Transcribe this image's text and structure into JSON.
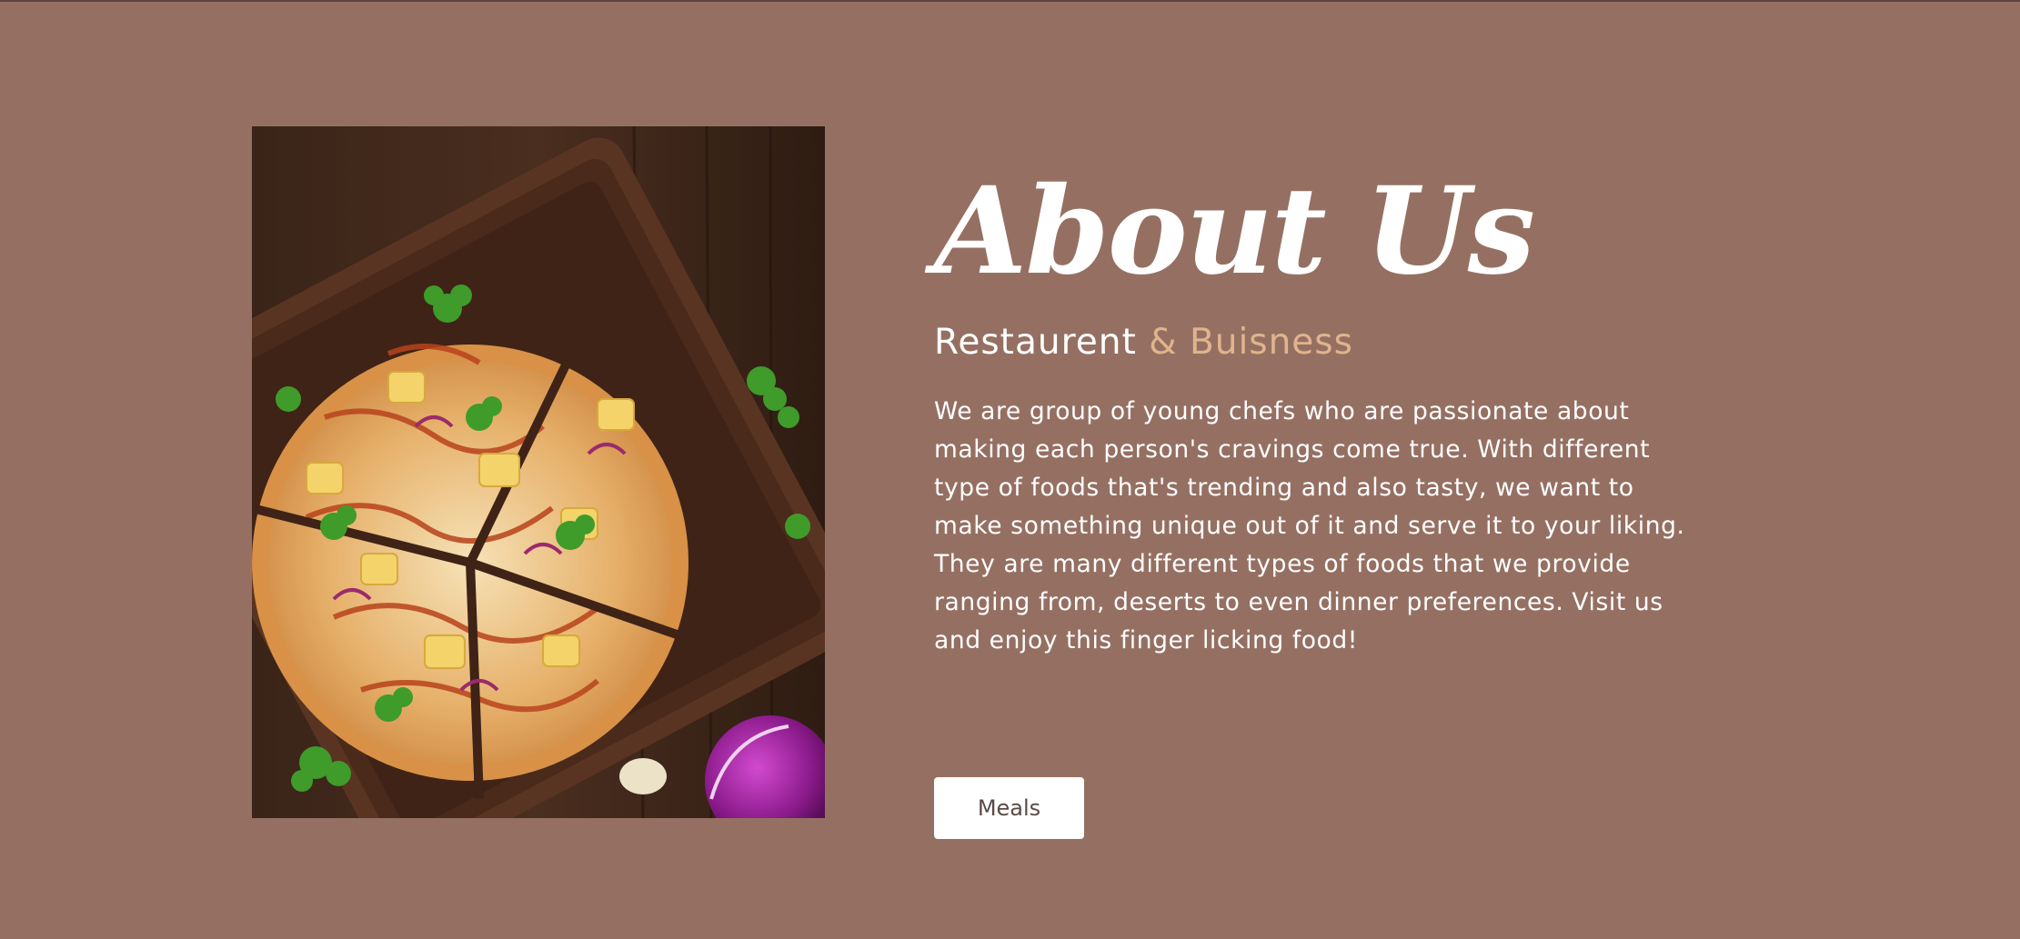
{
  "about": {
    "title": "About Us",
    "subtitle_main": "Restaurent",
    "subtitle_accent": "& Buisness",
    "description": "We are group of young chefs who are passionate about making each person's cravings come true. With different type of foods that's trending and also tasty, we want to make something unique out of it and serve it to your liking. They are many different types of foods that we provide ranging from, deserts to even dinner preferences. Visit us and enjoy this finger licking food!",
    "button_label": "Meals"
  },
  "image": {
    "subject": "pizza-on-wooden-board"
  },
  "colors": {
    "background": "#957062",
    "accent": "#e0b48c",
    "text": "#ffffff",
    "button_background": "#ffffff",
    "button_text": "#5a4a44"
  }
}
